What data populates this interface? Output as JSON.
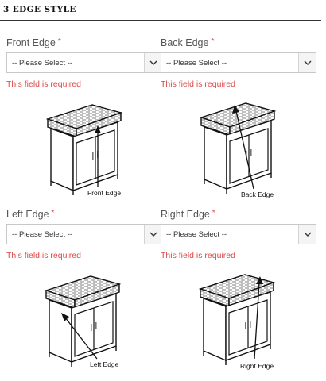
{
  "section": {
    "title": "3 EDGE STYLE"
  },
  "fields": [
    {
      "label": "Front Edge",
      "required_mark": "*",
      "selected": "-- Please Select --",
      "error": "This field is required",
      "caption": "Front Edge"
    },
    {
      "label": "Back Edge",
      "required_mark": "*",
      "selected": "-- Please Select --",
      "error": "This field is required",
      "caption": "Back Edge"
    },
    {
      "label": "Left Edge",
      "required_mark": "*",
      "selected": "-- Please Select --",
      "error": "This field is required",
      "caption": "Left Edge"
    },
    {
      "label": "Right Edge",
      "required_mark": "*",
      "selected": "-- Please Select --",
      "error": "This field is required",
      "caption": "Right Edge"
    }
  ],
  "colors": {
    "error": "#d94a4a",
    "rule": "#333333",
    "border": "#c8c8c8"
  },
  "icons": {
    "dropdown": "chevron-down-icon"
  }
}
